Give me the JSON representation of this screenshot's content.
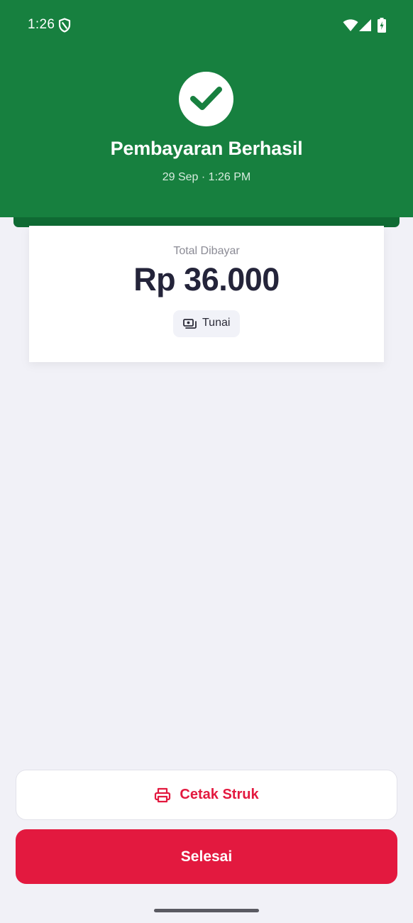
{
  "status_bar": {
    "time": "1:26",
    "icons": [
      "shield-icon",
      "wifi-icon",
      "cell-signal-icon",
      "battery-charging-icon"
    ]
  },
  "header": {
    "icon": "check-icon",
    "title": "Pembayaran Berhasil",
    "date": "29 Sep · 1:26 PM"
  },
  "receipt": {
    "total_label": "Total Dibayar",
    "total_amount": "Rp 36.000",
    "payment_method": {
      "icon": "cash-icon",
      "label": "Tunai"
    }
  },
  "actions": {
    "print_icon": "printer-icon",
    "print_label": "Cetak Struk",
    "done_label": "Selesai"
  },
  "colors": {
    "header_green": "#17803f",
    "slot_green": "#0f6a33",
    "accent_red": "#e3193f",
    "background": "#f1f1f7",
    "amount_text": "#24243a"
  }
}
